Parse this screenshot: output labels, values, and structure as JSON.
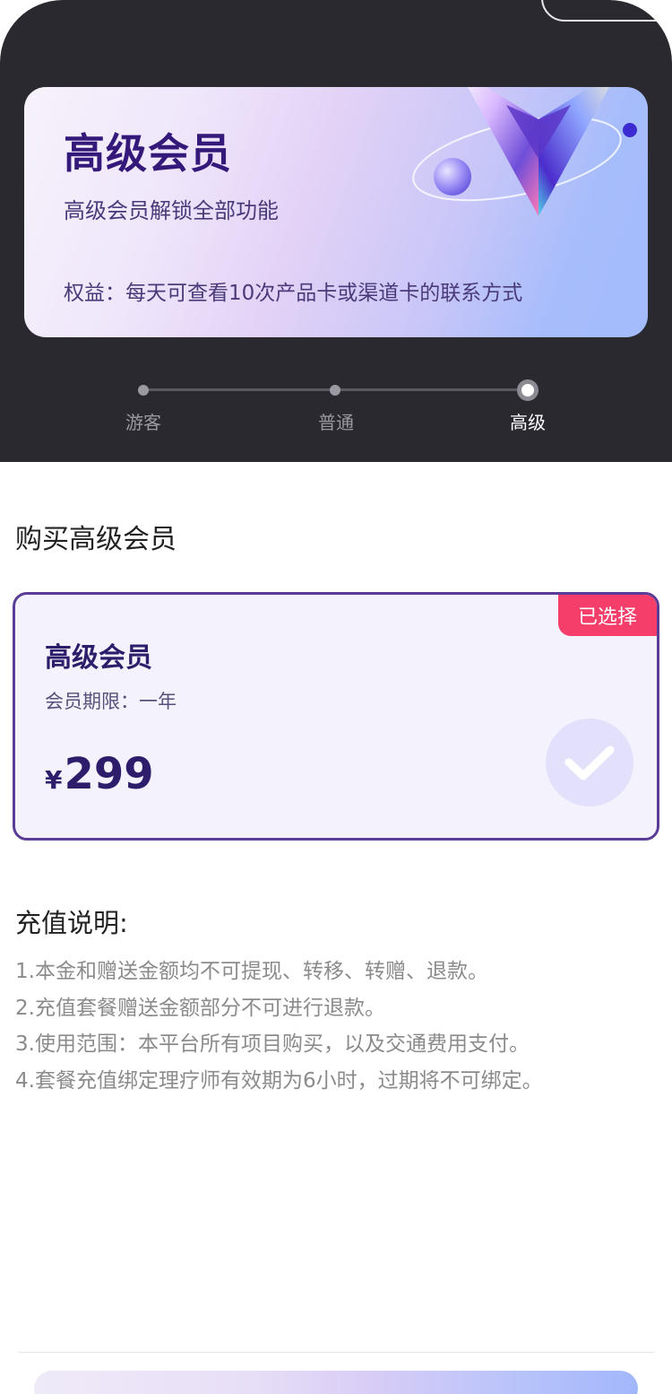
{
  "header": {
    "card": {
      "title": "高级会员",
      "subtitle": "高级会员解锁全部功能",
      "benefit": "权益：每天可查看10次产品卡或渠道卡的联系方式",
      "logo_icon": "v-crystal-logo-icon"
    },
    "levels": [
      {
        "label": "游客",
        "active": false
      },
      {
        "label": "普通",
        "active": false
      },
      {
        "label": "高级",
        "active": true
      }
    ]
  },
  "purchase": {
    "section_title": "购买高级会员",
    "plan": {
      "name": "高级会员",
      "period": "会员期限：一年",
      "currency_symbol": "¥",
      "price": "299",
      "badge": "已选择",
      "selected": true,
      "check_icon": "check-icon"
    }
  },
  "notes": {
    "title": "充值说明:",
    "items": [
      "1.本金和赠送金额均不可提现、转移、转赠、退款。",
      "2.充值套餐赠送金额部分不可进行退款。",
      "3.使用范围：本平台所有项目购买，以及交通费用支付。",
      "4.套餐充值绑定理疗师有效期为6小时，过期将不可绑定。"
    ]
  },
  "colors": {
    "header_bg": "#2a2930",
    "accent_purple": "#2e1d6b",
    "card_border": "#5b3c96",
    "badge_red": "#f53e6a",
    "note_gray": "#8b8b8b"
  }
}
